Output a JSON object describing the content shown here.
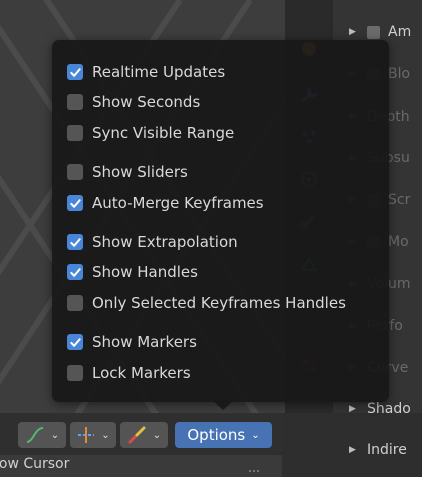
{
  "menu": {
    "items": [
      {
        "label": "Realtime Updates",
        "checked": true
      },
      {
        "label": "Show Seconds",
        "checked": false
      },
      {
        "label": "Sync Visible Range",
        "checked": false
      },
      {
        "label": "Show Sliders",
        "checked": false
      },
      {
        "label": "Auto-Merge Keyframes",
        "checked": true
      },
      {
        "label": "Show Extrapolation",
        "checked": true
      },
      {
        "label": "Show Handles",
        "checked": true
      },
      {
        "label": "Only Selected Keyframes Handles",
        "checked": false
      },
      {
        "label": "Show Markers",
        "checked": true
      },
      {
        "label": "Lock Markers",
        "checked": false
      }
    ]
  },
  "header": {
    "options_label": "Options",
    "below_label": "how Cursor"
  },
  "properties_panel": {
    "rows": [
      {
        "label": "Am",
        "checkbox": true
      },
      {
        "label": "Blo",
        "checkbox": true
      },
      {
        "label": "Depth",
        "checkbox": false
      },
      {
        "label": "Subsu",
        "checkbox": false
      },
      {
        "label": "Scr",
        "checkbox": true
      },
      {
        "label": "Mo",
        "checkbox": true
      },
      {
        "label": "Volum",
        "checkbox": false
      },
      {
        "label": "Perfo",
        "checkbox": false
      },
      {
        "label": "Curve",
        "checkbox": false
      },
      {
        "label": "Shado",
        "checkbox": false
      },
      {
        "label": "Indire",
        "checkbox": false
      }
    ]
  },
  "colors": {
    "accent": "#4772b3",
    "checkbox_on": "#4a86d8",
    "checkbox_off": "#555555",
    "menu_bg": "#181818"
  }
}
